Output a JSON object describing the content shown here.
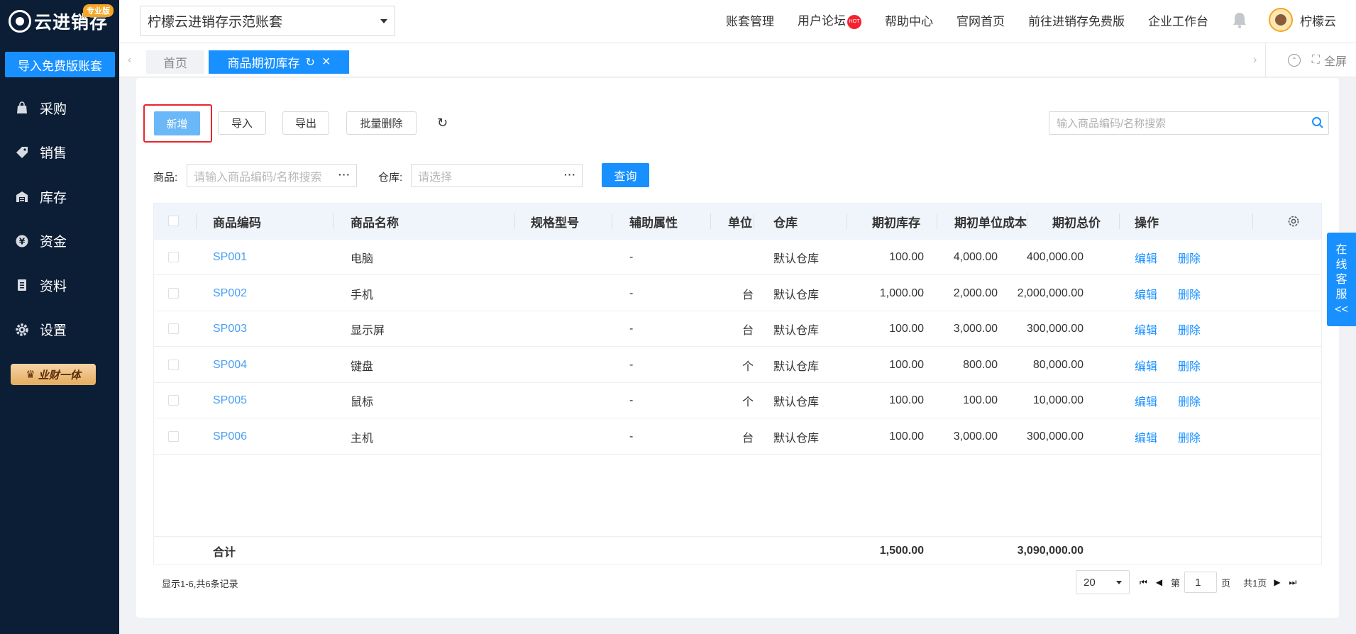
{
  "app": {
    "logo_text": "云进销存",
    "edition_badge": "专业版",
    "import_button": "导入免费版账套"
  },
  "sidebar": {
    "items": [
      {
        "label": "采购",
        "icon": "shopping-bag-icon"
      },
      {
        "label": "销售",
        "icon": "sales-tag-icon"
      },
      {
        "label": "库存",
        "icon": "warehouse-icon"
      },
      {
        "label": "资金",
        "icon": "yuan-coin-icon"
      },
      {
        "label": "资料",
        "icon": "document-icon"
      },
      {
        "label": "设置",
        "icon": "gear-icon"
      }
    ],
    "promo_label": "业财一体"
  },
  "topbar": {
    "account": "柠檬云进销存示范账套",
    "links": [
      "账套管理",
      "用户论坛",
      "帮助中心",
      "官网首页",
      "前往进销存免费版",
      "企业工作台"
    ],
    "hot_badge": "HOT",
    "username": "柠檬云"
  },
  "tabs": {
    "home": "首页",
    "active": "商品期初库存",
    "fullscreen": "全屏"
  },
  "toolbar": {
    "add": "新增",
    "import": "导入",
    "export": "导出",
    "bulk_delete": "批量删除",
    "search_placeholder": "输入商品编码/名称搜索"
  },
  "filters": {
    "product_label": "商品:",
    "product_placeholder": "请输入商品编码/名称搜索",
    "warehouse_label": "仓库:",
    "warehouse_placeholder": "请选择",
    "query": "查询"
  },
  "table": {
    "headers": {
      "code": "商品编码",
      "name": "商品名称",
      "spec": "规格型号",
      "attr": "辅助属性",
      "unit": "单位",
      "warehouse": "仓库",
      "qty": "期初库存",
      "unit_cost": "期初单位成本",
      "total": "期初总价",
      "ops": "操作"
    },
    "rows": [
      {
        "code": "SP001",
        "name": "电脑",
        "spec": "",
        "attr": "-",
        "unit": "",
        "warehouse": "默认仓库",
        "qty": "100.00",
        "unit_cost": "4,000.00",
        "total": "400,000.00",
        "edit": "编辑",
        "delete": "删除"
      },
      {
        "code": "SP002",
        "name": "手机",
        "spec": "",
        "attr": "-",
        "unit": "台",
        "warehouse": "默认仓库",
        "qty": "1,000.00",
        "unit_cost": "2,000.00",
        "total": "2,000,000.00",
        "edit": "编辑",
        "delete": "删除"
      },
      {
        "code": "SP003",
        "name": "显示屏",
        "spec": "",
        "attr": "-",
        "unit": "台",
        "warehouse": "默认仓库",
        "qty": "100.00",
        "unit_cost": "3,000.00",
        "total": "300,000.00",
        "edit": "编辑",
        "delete": "删除"
      },
      {
        "code": "SP004",
        "name": "键盘",
        "spec": "",
        "attr": "-",
        "unit": "个",
        "warehouse": "默认仓库",
        "qty": "100.00",
        "unit_cost": "800.00",
        "total": "80,000.00",
        "edit": "编辑",
        "delete": "删除"
      },
      {
        "code": "SP005",
        "name": "鼠标",
        "spec": "",
        "attr": "-",
        "unit": "个",
        "warehouse": "默认仓库",
        "qty": "100.00",
        "unit_cost": "100.00",
        "total": "10,000.00",
        "edit": "编辑",
        "delete": "删除"
      },
      {
        "code": "SP006",
        "name": "主机",
        "spec": "",
        "attr": "-",
        "unit": "台",
        "warehouse": "默认仓库",
        "qty": "100.00",
        "unit_cost": "3,000.00",
        "total": "300,000.00",
        "edit": "编辑",
        "delete": "删除"
      }
    ],
    "footer": {
      "label": "合计",
      "qty": "1,500.00",
      "total": "3,090,000.00"
    }
  },
  "pagination": {
    "records": "显示1-6,共6条记录",
    "page_size": "20",
    "page_prefix": "第",
    "current_page": "1",
    "page_suffix": "页",
    "total_pages": "共1页"
  },
  "service": [
    "在",
    "线",
    "客",
    "服",
    "<<"
  ]
}
